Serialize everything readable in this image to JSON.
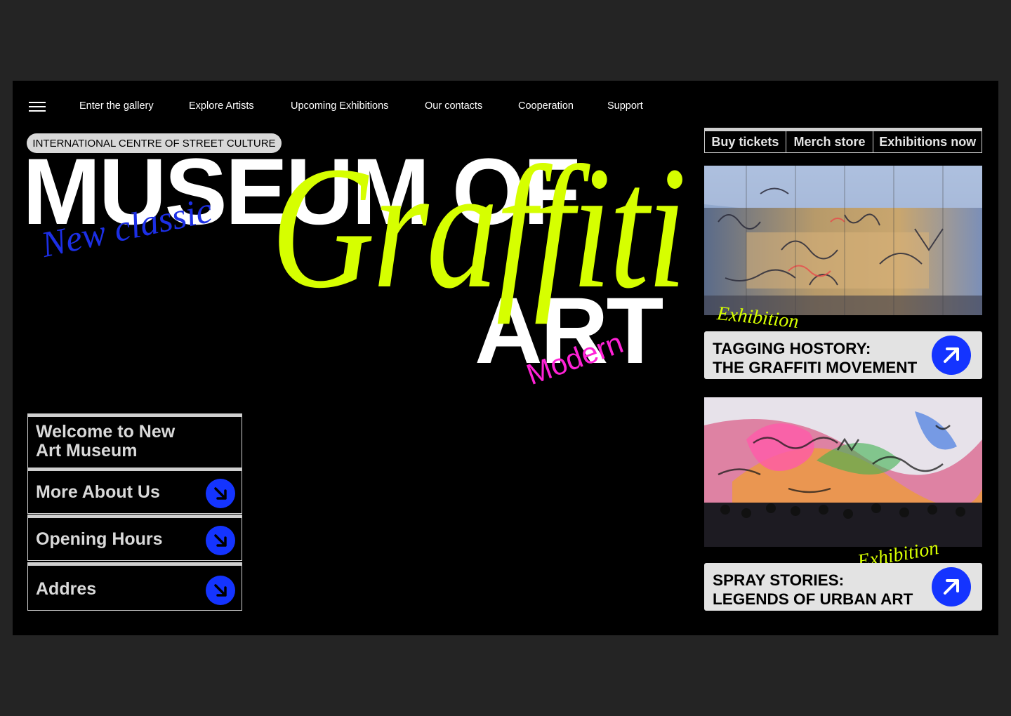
{
  "nav": {
    "links": [
      "Enter the gallery",
      "Explore Artists",
      "Upcoming Exhibitions",
      "Our contacts",
      "Cooperation",
      "Support"
    ]
  },
  "hero": {
    "tag": "INTERNATIONAL CENTRE OF STREET CULTURE",
    "title_line1": "MUSEUM OF",
    "title_script": "Graffiti",
    "title_line2": "ART",
    "accent_left": "New classic",
    "accent_right": "Modern"
  },
  "info_panel": {
    "welcome": "Welcome to New Art Museum",
    "welcome_line1": "Welcome to New",
    "welcome_line2": "Art Museum",
    "items": [
      {
        "label": "More About Us"
      },
      {
        "label": "Opening Hours"
      },
      {
        "label": "Addres"
      }
    ]
  },
  "tabs": [
    "Buy tickets",
    "Merch store",
    "Exhibitions now"
  ],
  "exhibitions": [
    {
      "tag": "Exhibition",
      "title_line1": "TAGGING HOSTORY:",
      "title_line2": "THE GRAFFITI MOVEMENT"
    },
    {
      "tag": "Exhibition",
      "title_line1": "SPRAY STORIES:",
      "title_line2": "LEGENDS OF URBAN ART"
    }
  ],
  "colors": {
    "background": "#000000",
    "page": "#242424",
    "accent_lime": "#d6ff00",
    "accent_blue": "#1434ff",
    "accent_magenta": "#ff22d6",
    "panel_grey": "#e3e3e3"
  },
  "icons": {
    "menu": "hamburger-icon",
    "panel_arrows": "arrow-down-right-icon",
    "card_arrows": "arrow-up-right-icon"
  }
}
